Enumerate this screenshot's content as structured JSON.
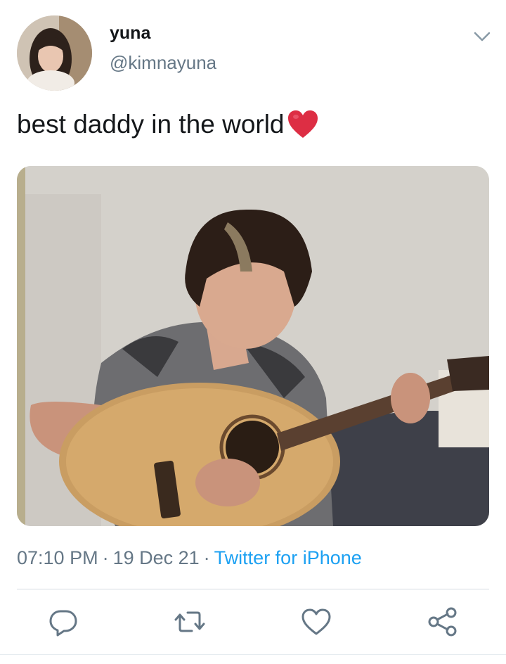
{
  "user": {
    "name": "yuna",
    "handle": "@kimnayuna"
  },
  "tweet": {
    "text": "best daddy in the world",
    "emoji": "heart"
  },
  "meta": {
    "time": "07:10 PM",
    "date": "19 Dec 21",
    "separator": "·",
    "source": "Twitter for iPhone"
  },
  "icons": {
    "caret": "chevron-down-icon",
    "reply": "reply-icon",
    "retweet": "retweet-icon",
    "like": "like-icon",
    "share": "share-icon"
  },
  "colors": {
    "text": "#14171a",
    "secondary": "#657786",
    "link": "#1da1f2",
    "divider": "#d4dbe1",
    "heart": "#e0245e"
  }
}
